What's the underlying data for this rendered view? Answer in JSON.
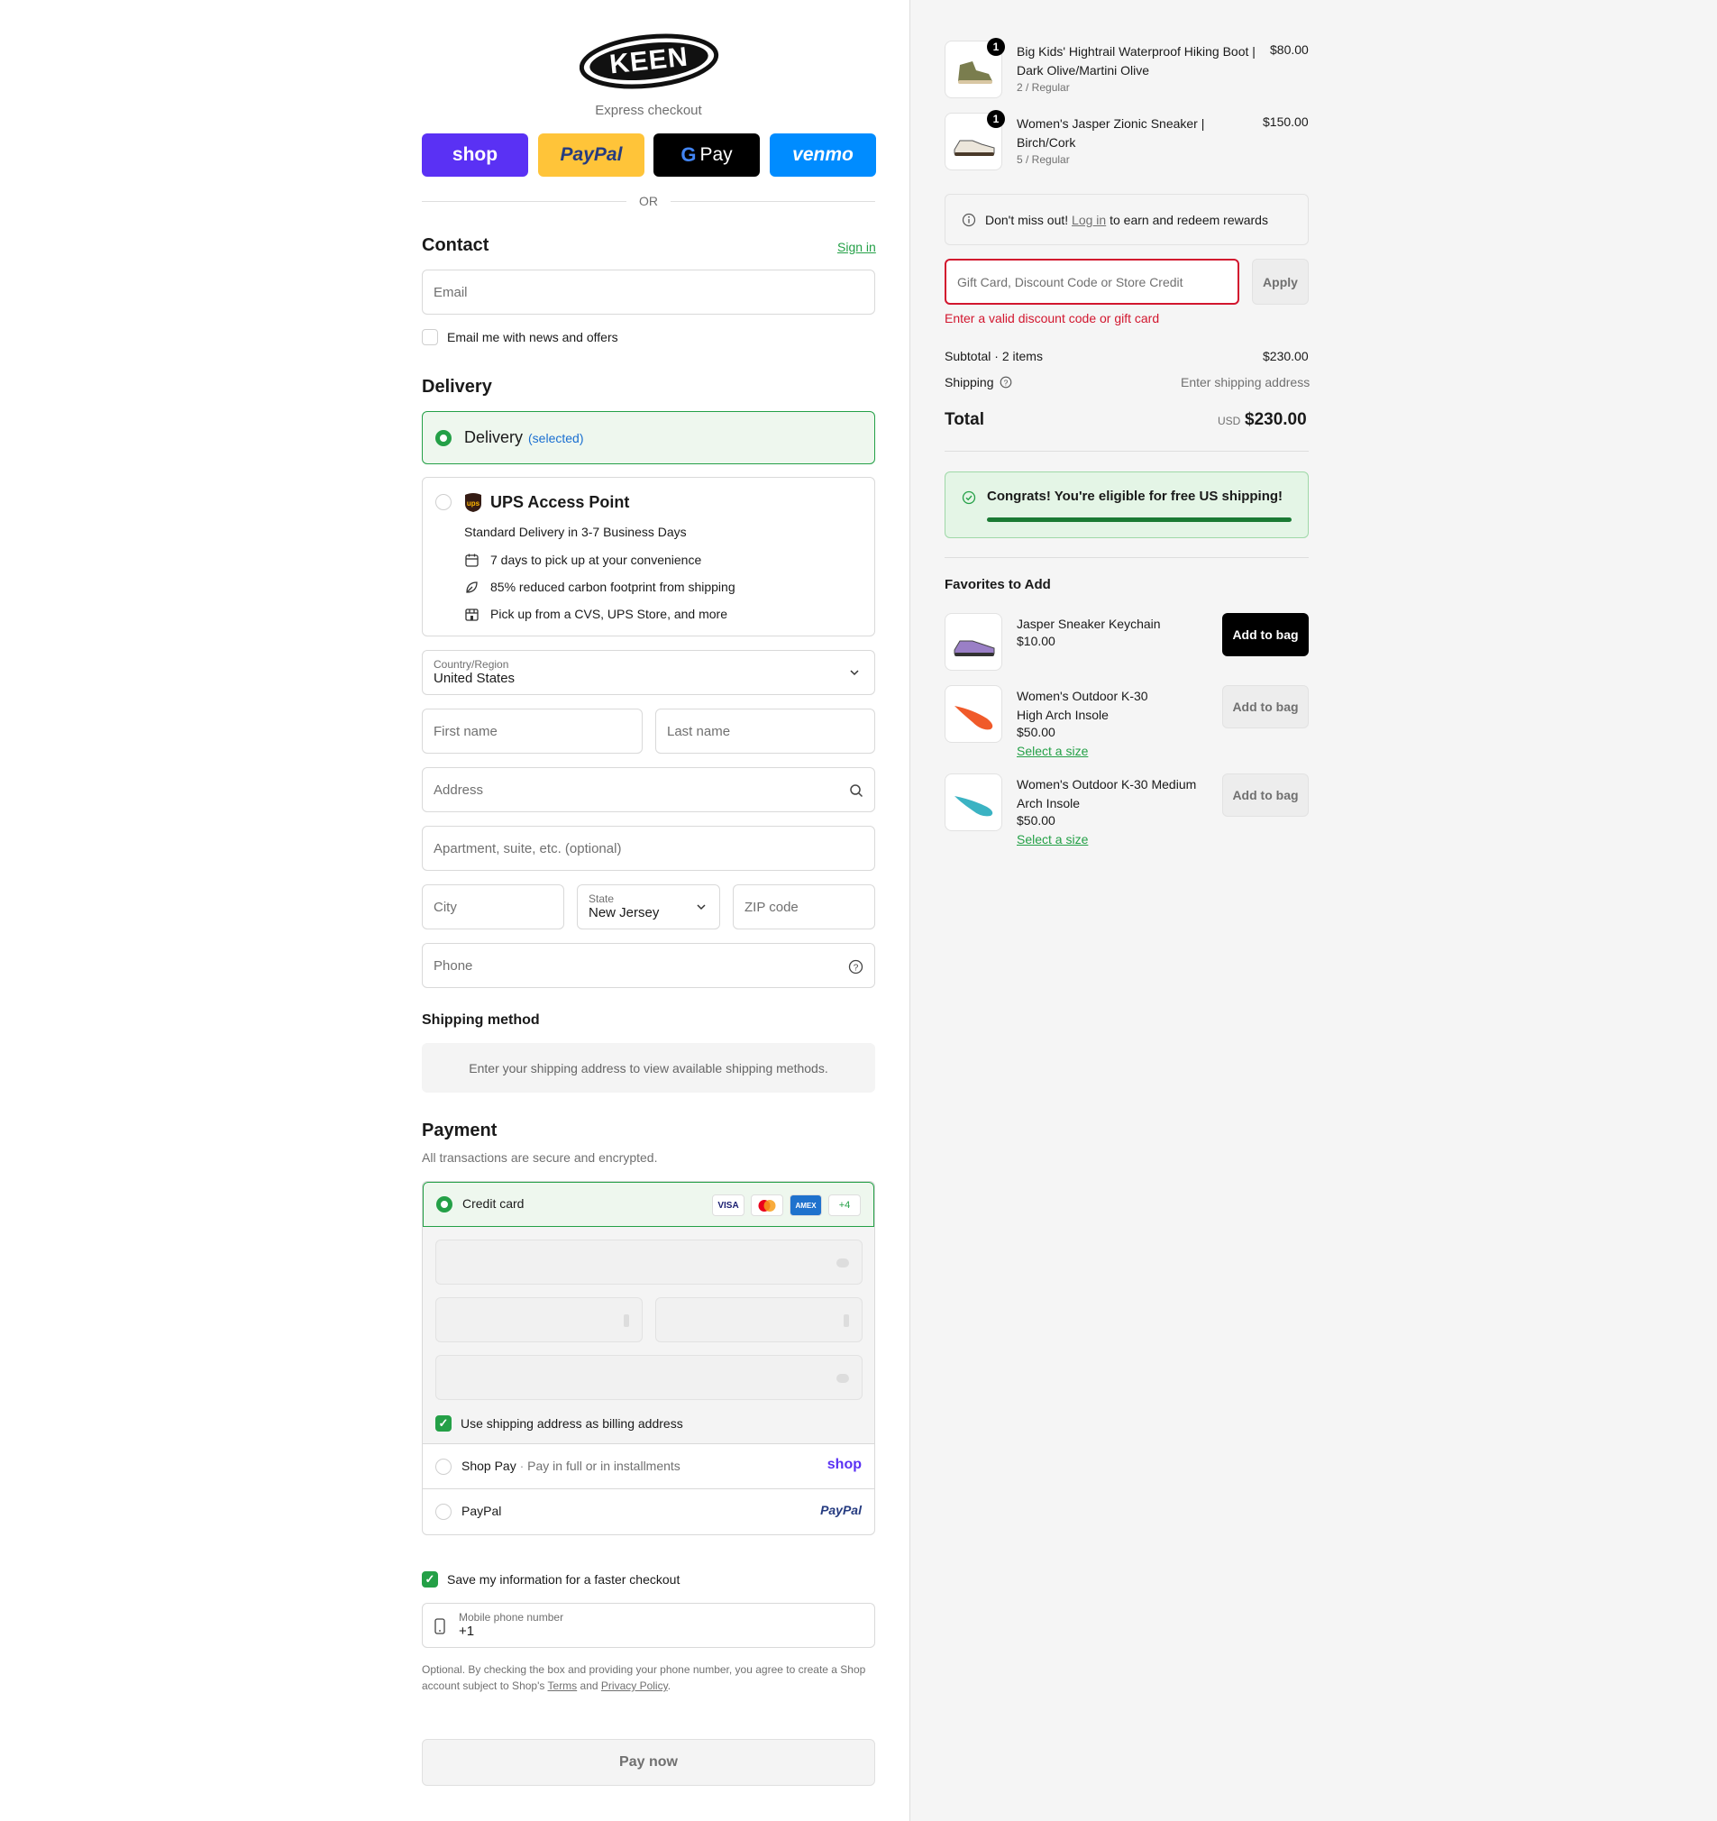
{
  "express": {
    "label": "Express checkout",
    "shop_label": "shop",
    "paypal_label": "PayPal",
    "gpay_label": "Pay",
    "venmo_label": "venmo",
    "or_label": "OR"
  },
  "contact": {
    "title": "Contact",
    "sign_in": "Sign in",
    "email_placeholder": "Email",
    "news_label": "Email me with news and offers"
  },
  "delivery": {
    "title": "Delivery",
    "option_delivery": "Delivery",
    "option_delivery_state": "(selected)",
    "ups_title": "UPS Access Point",
    "ups_subtitle": "Standard Delivery in 3-7 Business Days",
    "ups_features": [
      "7 days to pick up at your convenience",
      "85% reduced carbon footprint from shipping",
      "Pick up from a CVS, UPS Store, and more"
    ],
    "country_label": "Country/Region",
    "country_value": "United States",
    "first_name": "First name",
    "last_name": "Last name",
    "address": "Address",
    "apartment": "Apartment, suite, etc. (optional)",
    "city": "City",
    "state_label": "State",
    "state_value": "New Jersey",
    "zip": "ZIP code",
    "phone": "Phone"
  },
  "shipping_method": {
    "title": "Shipping method",
    "message": "Enter your shipping address to view available shipping methods."
  },
  "payment": {
    "title": "Payment",
    "subtitle": "All transactions are secure and encrypted.",
    "credit_card": "Credit card",
    "card_visa": "VISA",
    "card_amex": "AMEX",
    "card_more": "+4",
    "billing_label": "Use shipping address as billing address",
    "shop_pay": "Shop Pay",
    "shop_pay_sub": "Pay in full or in installments",
    "shop_pay_logo": "shop",
    "paypal": "PayPal",
    "paypal_logo": "PayPal"
  },
  "save_info": {
    "label": "Save my information for a faster checkout",
    "mobile_label": "Mobile phone number",
    "mobile_value": "+1",
    "disclaimer_1": "Optional. By checking the box and providing your phone number, you agree to create a Shop account subject to Shop's",
    "terms": "Terms",
    "and": "and",
    "privacy": "Privacy Policy",
    "period": "."
  },
  "pay_now": "Pay now",
  "order": {
    "items": [
      {
        "qty": "1",
        "name": "Big Kids' Hightrail Waterproof Hiking Boot | Dark Olive/Martini Olive",
        "variant": "2 / Regular",
        "price": "$80.00"
      },
      {
        "qty": "1",
        "name": "Women's Jasper Zionic Sneaker | Birch/Cork",
        "variant": "5 / Regular",
        "price": "$150.00"
      }
    ],
    "rewards_prefix": "Don't miss out!",
    "rewards_link": "Log in",
    "rewards_suffix": "to earn and redeem rewards",
    "discount_placeholder": "Gift Card, Discount Code or Store Credit",
    "apply": "Apply",
    "discount_error": "Enter a valid discount code or gift card",
    "subtotal_label": "Subtotal · 2 items",
    "subtotal_value": "$230.00",
    "shipping_label": "Shipping",
    "shipping_value": "Enter shipping address",
    "total_label": "Total",
    "total_currency": "USD",
    "total_value": "$230.00",
    "free_shipping": "Congrats! You're eligible for free US shipping!",
    "free_shipping_progress": 1.0
  },
  "favorites": {
    "title": "Favorites to Add",
    "items": [
      {
        "name": "Jasper Sneaker Keychain",
        "price": "$10.00",
        "button": "Add to bag"
      },
      {
        "name": "Women's Outdoor K-30 High Arch Insole",
        "price": "$50.00",
        "select": "Select a size",
        "button": "Add to bag"
      },
      {
        "name": "Women's Outdoor K-30 Medium Arch Insole",
        "price": "$50.00",
        "select": "Select a size",
        "button": "Add to bag"
      }
    ]
  },
  "colors": {
    "accent_green": "#24a047",
    "error_red": "#d2162e",
    "shop_purple": "#5a31f4",
    "paypal_yellow": "#ffc439",
    "venmo_blue": "#008cff"
  }
}
